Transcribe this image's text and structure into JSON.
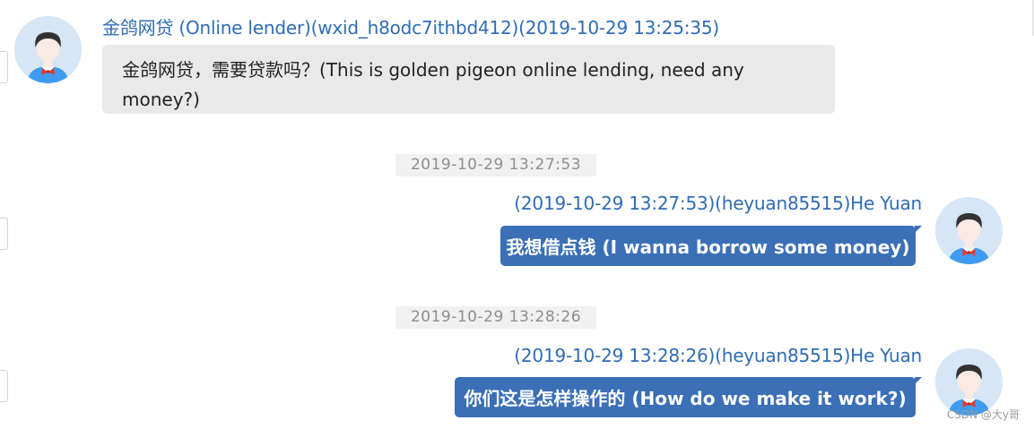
{
  "conversation": {
    "messages": [
      {
        "direction": "incoming",
        "sender": "金鸽网贷 (Online lender)(wxid_h8odc7ithbd412)(2019-10-29 13:25:35)",
        "text": "金鸽网贷，需要贷款吗？(This is golden pigeon online lending, need any money?)"
      },
      {
        "direction": "outgoing",
        "timestamp": "2019-10-29 13:27:53",
        "sender": "(2019-10-29 13:27:53)(heyuan85515)He Yuan",
        "text": "我想借点钱 (I wanna borrow some money)"
      },
      {
        "direction": "outgoing",
        "timestamp": "2019-10-29 13:28:26",
        "sender": "(2019-10-29 13:28:26)(heyuan85515)He Yuan",
        "text": "你们这是怎样操作的 (How do we make it work?)"
      }
    ]
  },
  "watermark": "CSDN @大y哥",
  "colors": {
    "link_blue": "#2f6cb5",
    "outgoing_bubble": "#3b6fb6",
    "incoming_bubble": "#e9e9e9",
    "avatar_bg": "#d6e6f5",
    "timestamp_bg": "#f1f1f1"
  }
}
